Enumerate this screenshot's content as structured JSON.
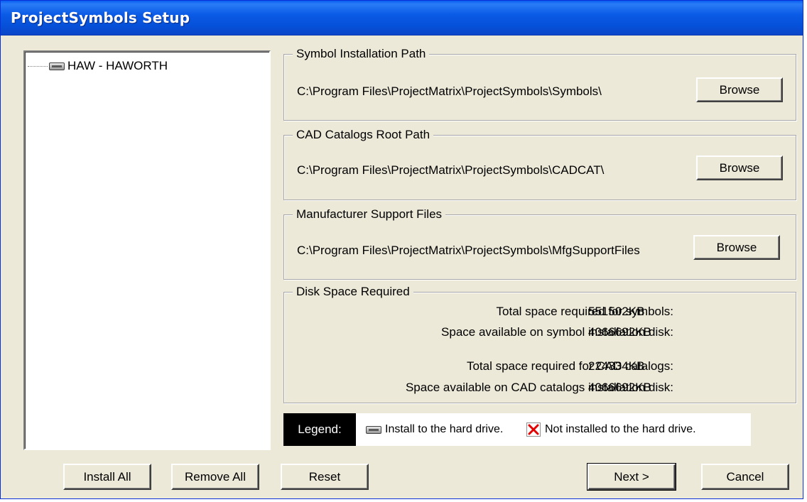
{
  "window": {
    "title": "ProjectSymbols Setup"
  },
  "tree": {
    "items": [
      {
        "label": "HAW - HAWORTH",
        "icon": "hard-drive-icon"
      }
    ]
  },
  "symbol_path": {
    "label": "Symbol Installation Path",
    "value": "C:\\Program Files\\ProjectMatrix\\ProjectSymbols\\Symbols\\",
    "button": "Browse"
  },
  "cad_path": {
    "label": "CAD Catalogs Root Path",
    "value": "C:\\Program Files\\ProjectMatrix\\ProjectSymbols\\CADCAT\\",
    "button": "Browse"
  },
  "mfg_path": {
    "label": "Manufacturer Support Files",
    "value": "C:\\Program Files\\ProjectMatrix\\ProjectSymbols\\MfgSupportFiles",
    "button": "Browse"
  },
  "disk": {
    "label": "Disk Space Required",
    "rows": [
      {
        "label": "Total space required for symbols:",
        "value": "551502KB"
      },
      {
        "label": "Space available on symbol installation disk:",
        "value": "4066692KB"
      },
      {
        "label": "Total space required for CAD catalogs:",
        "value": "224334KB"
      },
      {
        "label": "Space available on CAD catalogs installation disk:",
        "value": "4066692KB"
      }
    ]
  },
  "legend": {
    "label": "Legend:",
    "installed": "Install to the hard drive.",
    "not_installed": "Not installed to the hard drive."
  },
  "buttons": {
    "install_all": "Install All",
    "remove_all": "Remove All",
    "reset": "Reset",
    "next": "Next >",
    "cancel": "Cancel"
  },
  "colors": {
    "titlebar": "#0a5ef1",
    "dialog_bg": "#ece9d8",
    "not_installed_x": "#e00000"
  }
}
